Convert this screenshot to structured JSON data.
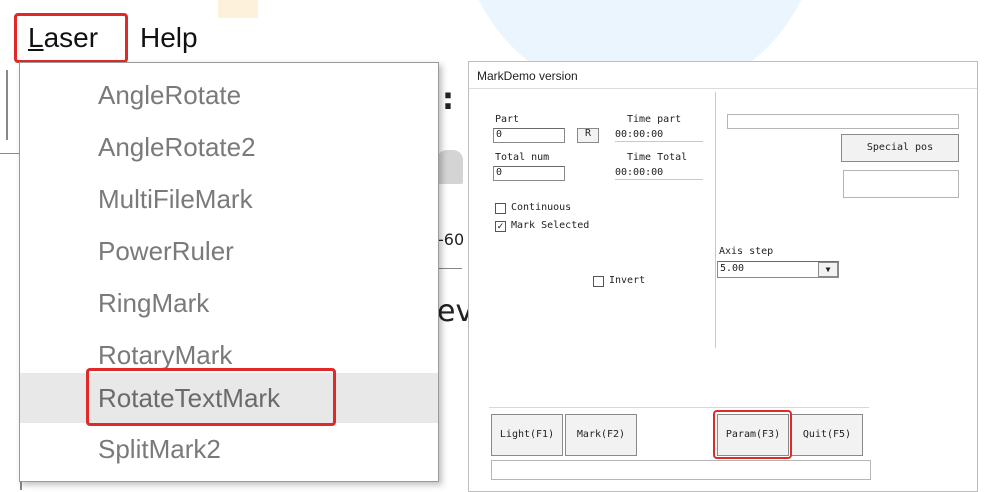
{
  "menubar": {
    "laser_accel": "L",
    "laser_rest": "aser",
    "help": "Help"
  },
  "background": {
    "frag_colon": ":",
    "frag_number": "-60",
    "frag_ev": "ev"
  },
  "laser_menu": {
    "items": [
      "AngleRotate",
      "AngleRotate2",
      "MultiFileMark",
      "PowerRuler",
      "RingMark",
      "RotaryMark",
      "RotateTextMark",
      "SplitMark2"
    ]
  },
  "dialog": {
    "title": "MarkDemo version",
    "part_label": "Part",
    "part_value": "0",
    "r_button": "R",
    "time_part_label": "Time part",
    "time_part_value": "00:00:00",
    "total_num_label": "Total num",
    "total_num_value": "0",
    "time_total_label": "Time Total",
    "time_total_value": "00:00:00",
    "continuous_label": "Continuous",
    "continuous_checked": false,
    "mark_selected_label": "Mark Selected",
    "mark_selected_checked": true,
    "mark_selected_check": "✓",
    "invert_label": "Invert",
    "invert_checked": false,
    "special_pos_button": "Special pos",
    "axis_step_label": "Axis step",
    "axis_step_value": "5.00",
    "dropdown_arrow": "▼",
    "buttons": {
      "light": "Light(F1)",
      "mark": "Mark(F2)",
      "param": "Param(F3)",
      "quit": "Quit(F5)"
    }
  },
  "colors": {
    "highlight": "#e02a2a",
    "menu_text": "#7a7a7a",
    "hover_bg": "#e8e8e8",
    "bg_accent": "#eaf5fd"
  }
}
